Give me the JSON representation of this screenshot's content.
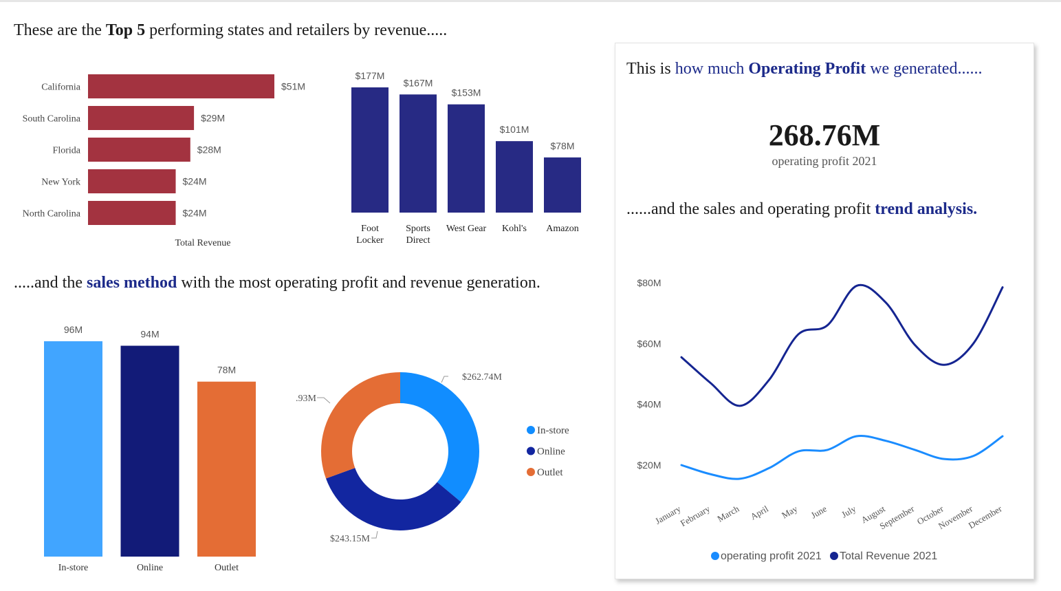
{
  "headings": {
    "top": {
      "pre": "These are the ",
      "bold": "Top 5",
      "post": " performing states and retailers by revenue....."
    },
    "sales": {
      "pre": ".....and the ",
      "bold": "sales method",
      "post": " with the most operating profit and revenue generation."
    },
    "profit": {
      "pre": "This is ",
      "mid": "how much ",
      "bold": "Operating Profit",
      "post": " we generated......"
    },
    "trend": {
      "pre": "......and the sales and operating profit ",
      "bold": "trend analysis."
    }
  },
  "kpi": {
    "value": "268.76M",
    "label": "operating profit 2021"
  },
  "colors": {
    "states": "#a33340",
    "retailers": "#272a84",
    "instore": "#41a5ff",
    "online": "#121b78",
    "outlet": "#e46d35",
    "donut_instore": "#118dff",
    "donut_online": "#1226a0",
    "line_profit": "#1a8cff",
    "line_revenue": "#152591",
    "accent": "#1c2a8a"
  },
  "chart_data": [
    {
      "type": "bar",
      "orientation": "horizontal",
      "categories": [
        "California",
        "South Carolina",
        "Florida",
        "New York",
        "North Carolina"
      ],
      "values": [
        51,
        29,
        28,
        24,
        24
      ],
      "labels": [
        "$51M",
        "$29M",
        "$28M",
        "$24M",
        "$24M"
      ],
      "xlabel": "Total Revenue"
    },
    {
      "type": "bar",
      "categories": [
        "Foot Locker",
        "Sports Direct",
        "West Gear",
        "Kohl's",
        "Amazon"
      ],
      "category_lines": [
        [
          "Foot",
          "Locker"
        ],
        [
          "Sports",
          "Direct"
        ],
        [
          "West Gear"
        ],
        [
          "Kohl's"
        ],
        [
          "Amazon"
        ]
      ],
      "values": [
        177,
        167,
        153,
        101,
        78
      ],
      "labels": [
        "$177M",
        "$167M",
        "$153M",
        "$101M",
        "$78M"
      ]
    },
    {
      "type": "bar",
      "categories": [
        "In-store",
        "Online",
        "Outlet"
      ],
      "values": [
        96,
        94,
        78
      ],
      "labels": [
        "96M",
        "94M",
        "78M"
      ]
    },
    {
      "type": "pie",
      "donut": true,
      "categories": [
        "In-store",
        "Online",
        "Outlet"
      ],
      "values": [
        262.74,
        243.15,
        222.93
      ],
      "labels": [
        "$262.74M",
        "$243.15M",
        ".93M"
      ],
      "legend": [
        "In-store",
        "Online",
        "Outlet"
      ]
    },
    {
      "type": "line",
      "x": [
        "January",
        "February",
        "March",
        "April",
        "May",
        "June",
        "July",
        "August",
        "September",
        "October",
        "November",
        "December"
      ],
      "series": [
        {
          "name": "operating profit 2021",
          "values": [
            20,
            17,
            15.5,
            19,
            24.5,
            25,
            29.5,
            28,
            25,
            22,
            23,
            29.5
          ]
        },
        {
          "name": "Total Revenue 2021",
          "values": [
            55.5,
            47,
            39.5,
            48,
            63,
            66,
            79,
            73.5,
            59.5,
            53,
            60,
            78.5
          ]
        }
      ],
      "yticks": [
        "$20M",
        "$40M",
        "$60M",
        "$80M"
      ],
      "ytick_values": [
        20,
        40,
        60,
        80
      ],
      "ylim": [
        12,
        84
      ],
      "legend": "bottom"
    }
  ]
}
